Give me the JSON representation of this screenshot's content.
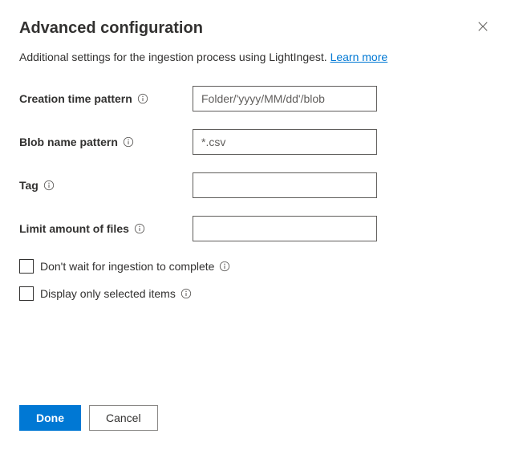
{
  "header": {
    "title": "Advanced configuration"
  },
  "subtitle": {
    "text": "Additional settings for the ingestion process using LightIngest. ",
    "link": "Learn more"
  },
  "fields": {
    "creation_time_pattern": {
      "label": "Creation time pattern",
      "placeholder": "Folder/'yyyy/MM/dd'/blob",
      "value": ""
    },
    "blob_name_pattern": {
      "label": "Blob name pattern",
      "placeholder": "*.csv",
      "value": ""
    },
    "tag": {
      "label": "Tag",
      "placeholder": "",
      "value": ""
    },
    "limit_files": {
      "label": "Limit amount of files",
      "placeholder": "",
      "value": ""
    }
  },
  "checkboxes": {
    "dont_wait": {
      "label": "Don't wait for ingestion to complete"
    },
    "display_selected": {
      "label": "Display only selected items"
    }
  },
  "footer": {
    "done": "Done",
    "cancel": "Cancel"
  }
}
